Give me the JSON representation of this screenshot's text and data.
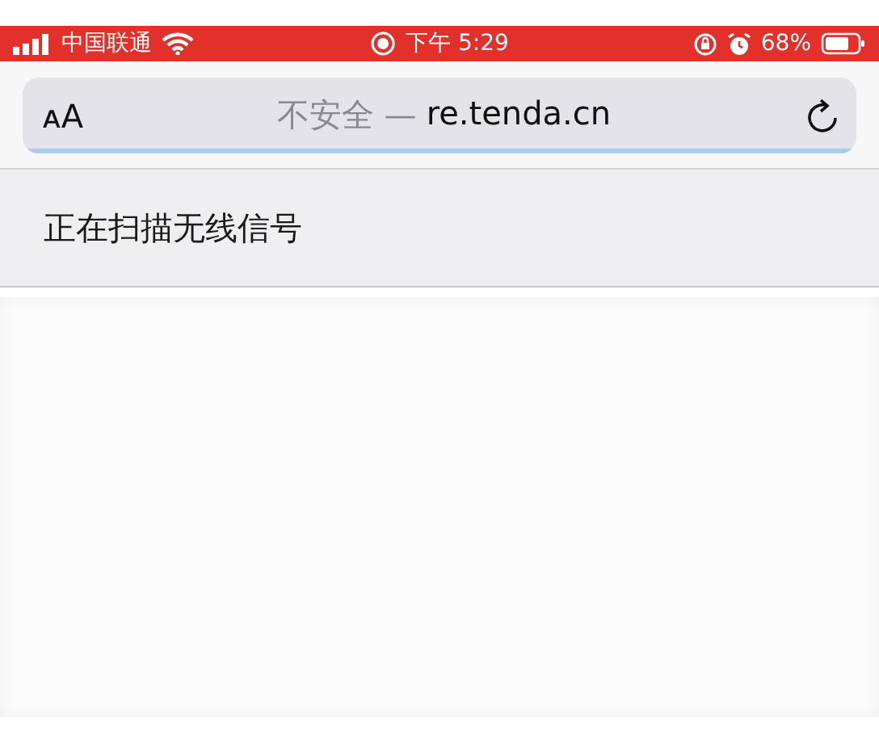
{
  "status_bar": {
    "carrier": "中国联通",
    "time": "下午 5:29",
    "battery": "68%"
  },
  "address_bar": {
    "text_size_button": "ᴀA",
    "security": "不安全 —",
    "domain": "re.tenda.cn",
    "progress": {
      "level": 1
    }
  },
  "banner": {
    "text": "正在扫描无线信号"
  }
}
